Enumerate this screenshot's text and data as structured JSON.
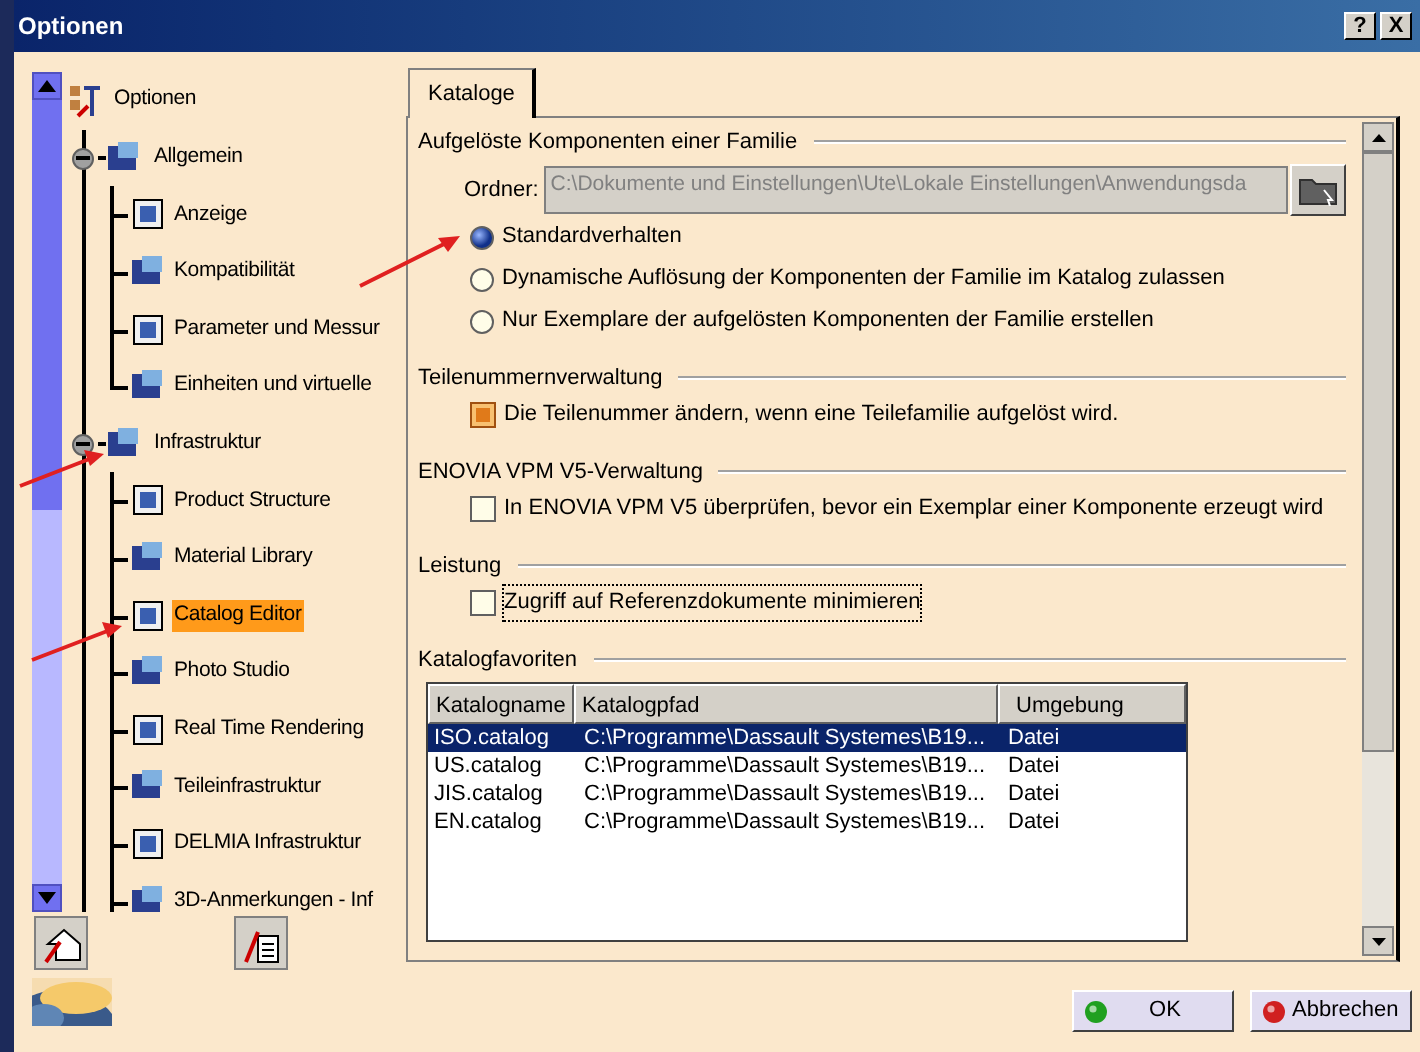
{
  "window": {
    "title": "Optionen",
    "buttons": [
      "?",
      "X"
    ]
  },
  "tree": {
    "label": "Optionen",
    "selected": false,
    "children": [
      {
        "label": "Allgemein",
        "expanded": true,
        "selected": false,
        "children": [
          {
            "label": "Anzeige",
            "selected": false
          },
          {
            "label": "Kompatibilität",
            "selected": false
          },
          {
            "label": "Parameter und Messur",
            "selected": false
          },
          {
            "label": "Einheiten und virtuelle",
            "selected": false
          }
        ]
      },
      {
        "label": "Infrastruktur",
        "expanded": true,
        "selected": false,
        "children": [
          {
            "label": "Product Structure",
            "selected": false
          },
          {
            "label": "Material Library",
            "selected": false
          },
          {
            "label": "Catalog Editor",
            "selected": true
          },
          {
            "label": "Photo Studio",
            "selected": false
          },
          {
            "label": "Real Time Rendering",
            "selected": false
          },
          {
            "label": "Teileinfrastruktur",
            "selected": false
          },
          {
            "label": "DELMIA Infrastruktur",
            "selected": false
          },
          {
            "label": "3D-Anmerkungen - Inf",
            "selected": false
          }
        ]
      }
    ]
  },
  "tabs": [
    {
      "label": "Kataloge",
      "selected": true
    }
  ],
  "sections": [
    {
      "title": "Aufgelöste Komponenten einer Familie",
      "folder": {
        "label": "Ordner:",
        "value": "C:\\Dokumente und Einstellungen\\Ute\\Lokale Einstellungen\\Anwendungsda"
      },
      "options": [
        {
          "kind": "radio",
          "label": "Standardverhalten",
          "checked": true
        },
        {
          "kind": "radio",
          "label": "Dynamische Auflösung der Komponenten der Familie im Katalog zulassen",
          "checked": false
        },
        {
          "kind": "radio",
          "label": "Nur Exemplare der aufgelösten Komponenten der Familie erstellen",
          "checked": false
        }
      ]
    },
    {
      "title": "Teilenummernverwaltung",
      "options": [
        {
          "kind": "checkbox",
          "label": "Die Teilenummer ändern, wenn eine Teilefamilie aufgelöst wird.",
          "checked": true
        }
      ]
    },
    {
      "title": "ENOVIA VPM V5-Verwaltung",
      "options": [
        {
          "kind": "checkbox",
          "label": "In ENOVIA VPM V5 überprüfen, bevor ein Exemplar einer Komponente erzeugt wird",
          "checked": false
        }
      ]
    },
    {
      "title": "Leistung",
      "options": [
        {
          "kind": "checkbox",
          "label": "Zugriff auf Referenzdokumente minimieren",
          "checked": false,
          "focused": true
        }
      ]
    },
    {
      "title": "Katalogfavoriten",
      "table": {
        "columns": [
          "Katalogname",
          "Katalogpfad",
          "Umgebung"
        ],
        "rows": [
          {
            "cells": [
              "ISO.catalog",
              "C:\\Programme\\Dassault Systemes\\B19...",
              "Datei"
            ],
            "selected": true
          },
          {
            "cells": [
              "US.catalog",
              "C:\\Programme\\Dassault Systemes\\B19...",
              "Datei"
            ],
            "selected": false
          },
          {
            "cells": [
              "JIS.catalog",
              "C:\\Programme\\Dassault Systemes\\B19...",
              "Datei"
            ],
            "selected": false
          },
          {
            "cells": [
              "EN.catalog",
              "C:\\Programme\\Dassault Systemes\\B19...",
              "Datei"
            ],
            "selected": false
          }
        ]
      }
    }
  ],
  "buttons": [
    {
      "label": "OK",
      "kind": "ok"
    },
    {
      "label": "Abbrechen",
      "kind": "cancel"
    }
  ]
}
